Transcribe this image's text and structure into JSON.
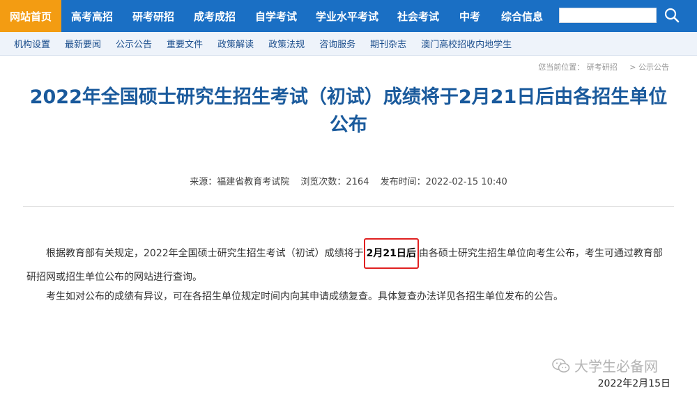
{
  "topnav": {
    "items": [
      {
        "label": "网站首页",
        "active": true
      },
      {
        "label": "高考高招",
        "active": false
      },
      {
        "label": "研考研招",
        "active": false
      },
      {
        "label": "成考成招",
        "active": false
      },
      {
        "label": "自学考试",
        "active": false
      },
      {
        "label": "学业水平考试",
        "active": false
      },
      {
        "label": "社会考试",
        "active": false
      },
      {
        "label": "中考",
        "active": false
      },
      {
        "label": "综合信息",
        "active": false
      }
    ],
    "search_value": "",
    "search_icon": "magnifier-icon",
    "color": "#1a6fc4",
    "active_color": "#f39c12"
  },
  "subnav": {
    "items": [
      "机构设置",
      "最新要闻",
      "公示公告",
      "重要文件",
      "政策解读",
      "政策法规",
      "咨询服务",
      "期刊杂志",
      "澳门高校招收内地学生"
    ]
  },
  "breadcrumb": {
    "prefix": "您当前位置：",
    "items": [
      "研考研招",
      "> 公示公告"
    ]
  },
  "article": {
    "title": "2022年全国硕士研究生招生考试（初试）成绩将于2月21日后由各招生单位公布",
    "meta": {
      "source": "来源：福建省教育考试院",
      "views": "浏览次数：2164",
      "published": "发布时间：2022-02-15 10:40"
    },
    "para1_before": "根据教育部有关规定，2022年全国硕士研究生招生考试（初试）成绩将于",
    "para1_highlight": "2月21日后",
    "para1_after": "由各硕士研究生招生单位向考生公布，考生可通过教育部研招网或招生单位公布的网站进行查询。",
    "para2": "考生如对公布的成绩有异议，可在各招生单位规定时间内向其申请成绩复查。具体复查办法详见各招生单位发布的公告。"
  },
  "watermark": {
    "text": "大学生必备网",
    "icon": "wechat-icon"
  },
  "footer": {
    "date": "2022年2月15日"
  }
}
